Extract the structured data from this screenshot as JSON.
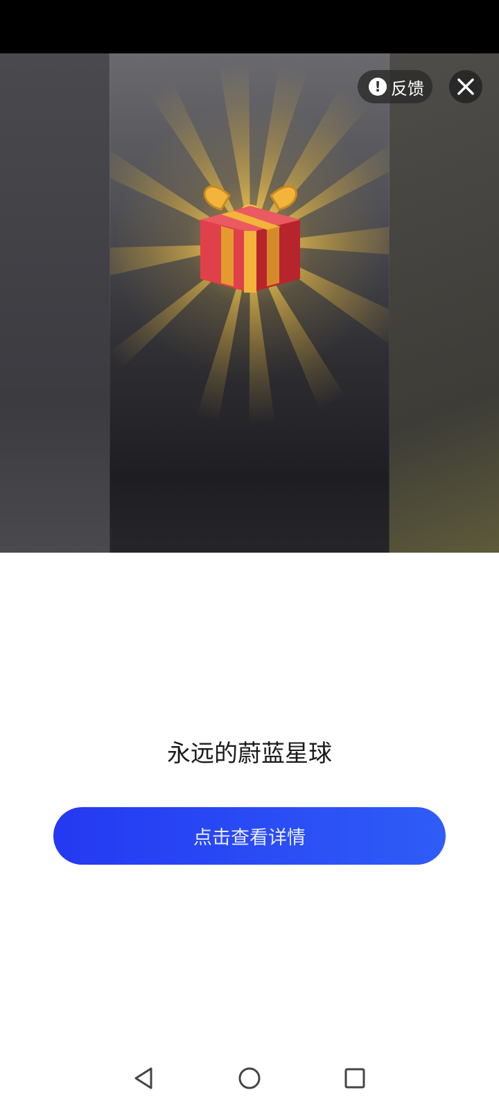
{
  "ad": {
    "feedback_label": "反馈",
    "title": "永远的蔚蓝星球",
    "cta_label": "点击查看详情"
  },
  "colors": {
    "cta_start": "#2439f2",
    "cta_end": "#2f5cf7",
    "gift_red": "#d8323a",
    "ribbon_gold": "#f2b43a"
  },
  "icons": {
    "feedback": "alert-circle-icon",
    "close": "close-icon",
    "gift": "gift-box-icon",
    "nav_back": "back-triangle-icon",
    "nav_home": "home-circle-icon",
    "nav_recents": "recents-square-icon"
  }
}
